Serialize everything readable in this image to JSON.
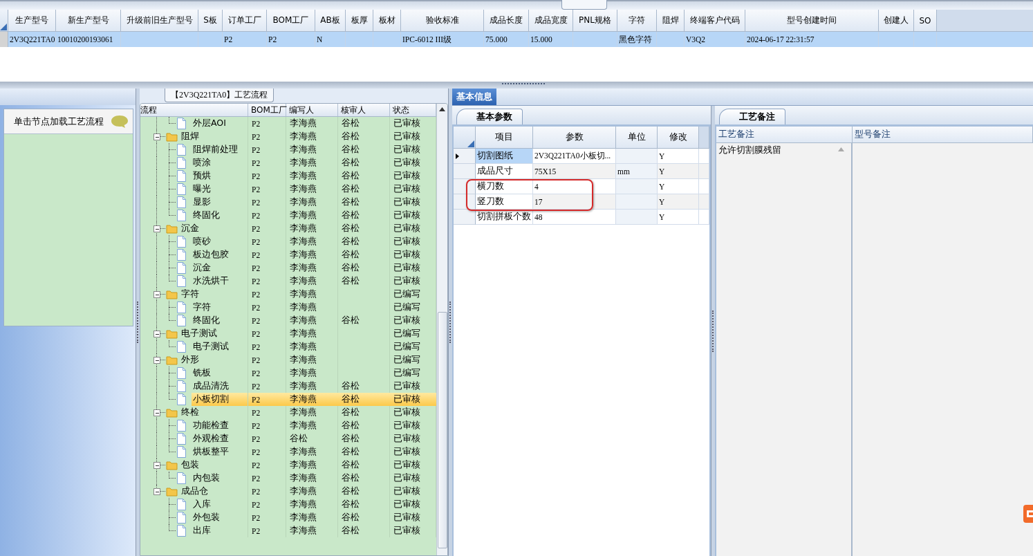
{
  "main_grid": {
    "columns": [
      "生产型号",
      "新生产型号",
      "升级前旧生产型号",
      "S板",
      "订单工厂",
      "BOM工厂",
      "AB板",
      "板厚",
      "板材",
      "验收标准",
      "成品长度",
      "成品宽度",
      "PNL规格",
      "字符",
      "阻焊",
      "终端客户代码",
      "型号创建时间",
      "创建人",
      "SO"
    ],
    "rows": [
      {
        "selected": true,
        "cells": [
          "2V3Q221TA0",
          "10010200193061",
          "",
          "",
          "P2",
          "P2",
          "N",
          "",
          "",
          "IPC-6012 III级",
          "75.000",
          "15.000",
          "",
          "黑色字符",
          "",
          "V3Q2",
          "2024-06-17 22:31:57",
          "",
          ""
        ]
      }
    ]
  },
  "left_panel": {
    "hint": "单击节点加载工艺流程"
  },
  "process_tree": {
    "title": "【2V3Q221TA0】工艺流程",
    "columns": [
      "流程",
      "BOM工厂",
      "编写人",
      "核审人",
      "状态"
    ],
    "nodes": [
      {
        "kind": "continued",
        "children": [
          {
            "kind": "step",
            "label": "外层AOI",
            "bom_factory": "P2",
            "writer": "李海燕",
            "reviewer": "谷松",
            "status": "已审核",
            "selected": false
          }
        ]
      },
      {
        "kind": "group",
        "label": "阻焊",
        "bom_factory": "P2",
        "writer": "李海燕",
        "reviewer": "谷松",
        "status": "已审核",
        "selected": false,
        "expanded": true,
        "children": [
          {
            "kind": "step",
            "label": "阻焊前处理",
            "bom_factory": "P2",
            "writer": "李海燕",
            "reviewer": "谷松",
            "status": "已审核",
            "selected": false
          },
          {
            "kind": "step",
            "label": "喷涂",
            "bom_factory": "P2",
            "writer": "李海燕",
            "reviewer": "谷松",
            "status": "已审核",
            "selected": false
          },
          {
            "kind": "step",
            "label": "预烘",
            "bom_factory": "P2",
            "writer": "李海燕",
            "reviewer": "谷松",
            "status": "已审核",
            "selected": false
          },
          {
            "kind": "step",
            "label": "曝光",
            "bom_factory": "P2",
            "writer": "李海燕",
            "reviewer": "谷松",
            "status": "已审核",
            "selected": false
          },
          {
            "kind": "step",
            "label": "显影",
            "bom_factory": "P2",
            "writer": "李海燕",
            "reviewer": "谷松",
            "status": "已审核",
            "selected": false
          },
          {
            "kind": "step",
            "label": "终固化",
            "bom_factory": "P2",
            "writer": "李海燕",
            "reviewer": "谷松",
            "status": "已审核",
            "selected": false
          }
        ]
      },
      {
        "kind": "group",
        "label": "沉金",
        "bom_factory": "P2",
        "writer": "李海燕",
        "reviewer": "谷松",
        "status": "已审核",
        "selected": false,
        "expanded": true,
        "children": [
          {
            "kind": "step",
            "label": "喷砂",
            "bom_factory": "P2",
            "writer": "李海燕",
            "reviewer": "谷松",
            "status": "已审核",
            "selected": false
          },
          {
            "kind": "step",
            "label": "板边包胶",
            "bom_factory": "P2",
            "writer": "李海燕",
            "reviewer": "谷松",
            "status": "已审核",
            "selected": false
          },
          {
            "kind": "step",
            "label": "沉金",
            "bom_factory": "P2",
            "writer": "李海燕",
            "reviewer": "谷松",
            "status": "已审核",
            "selected": false
          },
          {
            "kind": "step",
            "label": "水洗烘干",
            "bom_factory": "P2",
            "writer": "李海燕",
            "reviewer": "谷松",
            "status": "已审核",
            "selected": false
          }
        ]
      },
      {
        "kind": "group",
        "label": "字符",
        "bom_factory": "P2",
        "writer": "李海燕",
        "status": "已编写",
        "selected": false,
        "expanded": true,
        "children": [
          {
            "kind": "step",
            "label": "字符",
            "bom_factory": "P2",
            "writer": "李海燕",
            "status": "已编写",
            "selected": false
          },
          {
            "kind": "step",
            "label": "终固化",
            "bom_factory": "P2",
            "writer": "李海燕",
            "reviewer": "谷松",
            "status": "已审核",
            "selected": false
          }
        ]
      },
      {
        "kind": "group",
        "label": "电子测试",
        "bom_factory": "P2",
        "writer": "李海燕",
        "status": "已编写",
        "selected": false,
        "expanded": true,
        "children": [
          {
            "kind": "step",
            "label": "电子测试",
            "bom_factory": "P2",
            "writer": "李海燕",
            "status": "已编写",
            "selected": false
          }
        ]
      },
      {
        "kind": "group",
        "label": "外形",
        "bom_factory": "P2",
        "writer": "李海燕",
        "status": "已编写",
        "selected": false,
        "expanded": true,
        "children": [
          {
            "kind": "step",
            "label": "铣板",
            "bom_factory": "P2",
            "writer": "李海燕",
            "status": "已编写",
            "selected": false
          },
          {
            "kind": "step",
            "label": "成品清洗",
            "bom_factory": "P2",
            "writer": "李海燕",
            "reviewer": "谷松",
            "status": "已审核",
            "selected": false
          },
          {
            "kind": "step",
            "label": "小板切割",
            "bom_factory": "P2",
            "writer": "李海燕",
            "reviewer": "谷松",
            "status": "已审核",
            "selected": true
          }
        ]
      },
      {
        "kind": "group",
        "label": "终检",
        "bom_factory": "P2",
        "writer": "李海燕",
        "reviewer": "谷松",
        "status": "已审核",
        "selected": false,
        "expanded": true,
        "children": [
          {
            "kind": "step",
            "label": "功能检查",
            "bom_factory": "P2",
            "writer": "李海燕",
            "reviewer": "谷松",
            "status": "已审核",
            "selected": false
          },
          {
            "kind": "step",
            "label": "外观检查",
            "bom_factory": "P2",
            "writer": "谷松",
            "reviewer": "谷松",
            "status": "已审核",
            "selected": false
          },
          {
            "kind": "step",
            "label": "烘板整平",
            "bom_factory": "P2",
            "writer": "李海燕",
            "reviewer": "谷松",
            "status": "已审核",
            "selected": false
          }
        ]
      },
      {
        "kind": "group",
        "label": "包装",
        "bom_factory": "P2",
        "writer": "李海燕",
        "reviewer": "谷松",
        "status": "已审核",
        "selected": false,
        "expanded": true,
        "children": [
          {
            "kind": "step",
            "label": "内包装",
            "bom_factory": "P2",
            "writer": "李海燕",
            "reviewer": "谷松",
            "status": "已审核",
            "selected": false
          }
        ]
      },
      {
        "kind": "group",
        "label": "成品仓",
        "bom_factory": "P2",
        "writer": "李海燕",
        "reviewer": "谷松",
        "status": "已审核",
        "selected": false,
        "expanded": true,
        "children": [
          {
            "kind": "step",
            "label": "入库",
            "bom_factory": "P2",
            "writer": "李海燕",
            "reviewer": "谷松",
            "status": "已审核",
            "selected": false
          },
          {
            "kind": "step",
            "label": "外包装",
            "bom_factory": "P2",
            "writer": "李海燕",
            "reviewer": "谷松",
            "status": "已审核",
            "selected": false
          },
          {
            "kind": "step",
            "label": "出库",
            "bom_factory": "P2",
            "writer": "李海燕",
            "reviewer": "谷松",
            "status": "已审核",
            "selected": false
          }
        ]
      }
    ]
  },
  "detail_tabs": [
    {
      "label": "基本信息",
      "selected": true
    }
  ],
  "params": {
    "tab": "基本参数",
    "columns": [
      "项目",
      "参数",
      "单位",
      "修改"
    ],
    "rows": [
      {
        "selected": true,
        "item": "切割图纸",
        "value": "2V3Q221TA0小板切...",
        "modify": "Y"
      },
      {
        "selected": false,
        "item": "成品尺寸",
        "value": "75X15",
        "unit": "mm",
        "modify": "Y"
      },
      {
        "selected": false,
        "item": "横刀数",
        "value": "4",
        "modify": "Y"
      },
      {
        "selected": false,
        "item": "竖刀数",
        "value": "17",
        "modify": "Y"
      },
      {
        "selected": false,
        "item": "切割拼板个数",
        "value": "48",
        "modify": "Y"
      }
    ]
  },
  "notes": {
    "tab": "工艺备注",
    "columns": [
      "工艺备注",
      "型号备注"
    ],
    "process_note": "允许切割膜残留"
  }
}
